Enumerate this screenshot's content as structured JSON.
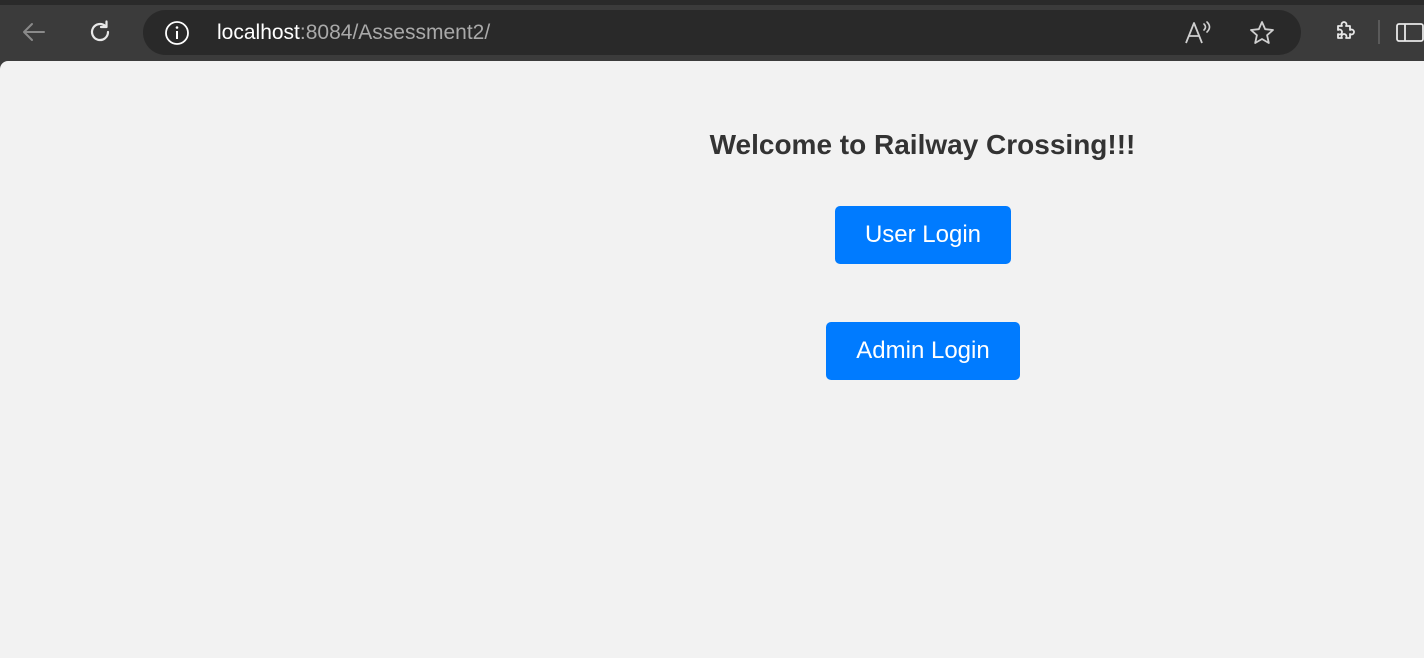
{
  "browser": {
    "url_host": "localhost",
    "url_rest": ":8084/Assessment2/",
    "read_aloud_glyph": "A",
    "icons": [
      "back-arrow-icon",
      "reload-icon",
      "site-info-icon",
      "read-aloud-icon",
      "favorite-star-icon",
      "extensions-icon",
      "split-screen-icon"
    ]
  },
  "page": {
    "title": "Welcome to Railway Crossing!!!",
    "user_login_label": "User Login",
    "admin_login_label": "Admin Login"
  },
  "colors": {
    "button_bg": "#007bff",
    "page_bg": "#f2f2f2",
    "toolbar_bg": "#3b3b3b"
  }
}
